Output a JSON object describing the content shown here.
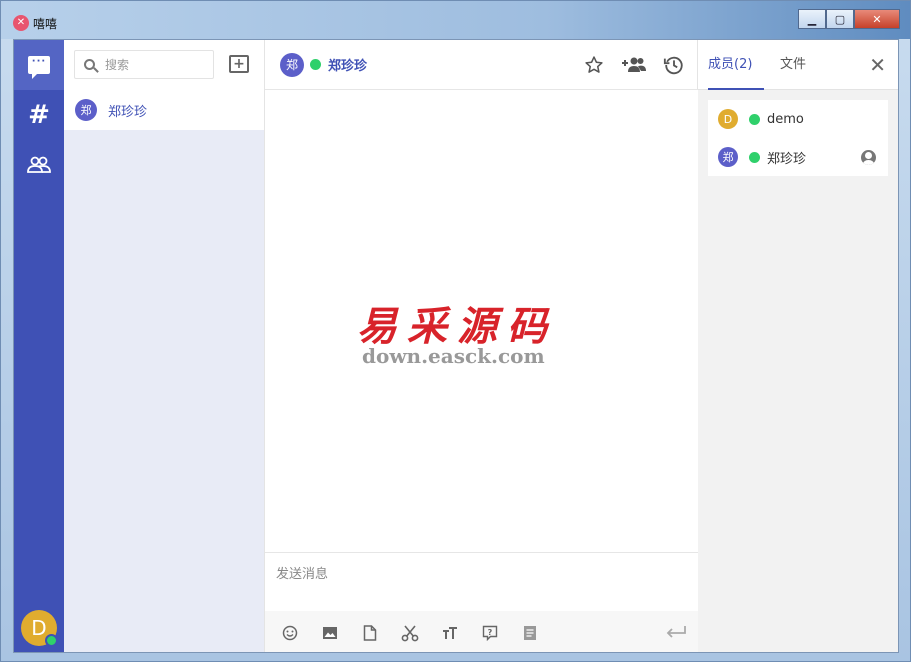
{
  "window": {
    "title": "嘻嘻",
    "app_icon": "x-logo-icon",
    "controls": {
      "minimize": "▁",
      "maximize": "▢",
      "close": "✕"
    }
  },
  "rail": {
    "items": [
      {
        "name": "chats",
        "icon": "chat-bubble-icon",
        "glyph": "···",
        "active": true
      },
      {
        "name": "channels",
        "icon": "hash-icon",
        "glyph": "#",
        "active": false
      },
      {
        "name": "contacts",
        "icon": "group-icon",
        "glyph": "👥",
        "active": false
      }
    ],
    "user_avatar": {
      "initial": "D",
      "color": "#e0ac2f",
      "online": true
    }
  },
  "conversation_list": {
    "search_placeholder": "搜索",
    "new_chat_icon": "add-chat-icon",
    "items": [
      {
        "avatar": "郑",
        "name": "郑珍珍",
        "selected": true
      }
    ]
  },
  "chat": {
    "header": {
      "avatar": "郑",
      "title": "郑珍珍",
      "online": true
    },
    "header_icons": [
      "star-icon",
      "add-member-icon",
      "history-icon"
    ],
    "watermark": {
      "cn": "易采源码",
      "en": "down.easck.com"
    },
    "composer": {
      "placeholder": "发送消息"
    },
    "toolbar": [
      "emoji-icon",
      "image-icon",
      "file-icon",
      "scissors-icon",
      "font-size-icon",
      "quote-icon",
      "note-icon"
    ],
    "send_icon": "send-enter-icon"
  },
  "side_panel": {
    "tabs": [
      {
        "label": "成员(2)",
        "active": true
      },
      {
        "label": "文件",
        "active": false
      }
    ],
    "close_glyph": "✕",
    "members": [
      {
        "avatar": "D",
        "color": "#e0ac2f",
        "name": "demo",
        "online": true,
        "owner": false
      },
      {
        "avatar": "郑",
        "color": "#5c5fc9",
        "name": "郑珍珍",
        "online": true,
        "owner": true
      }
    ]
  },
  "colors": {
    "primary": "#3f51b5",
    "online": "#2fd06b",
    "watermark_red": "#d8232a"
  }
}
